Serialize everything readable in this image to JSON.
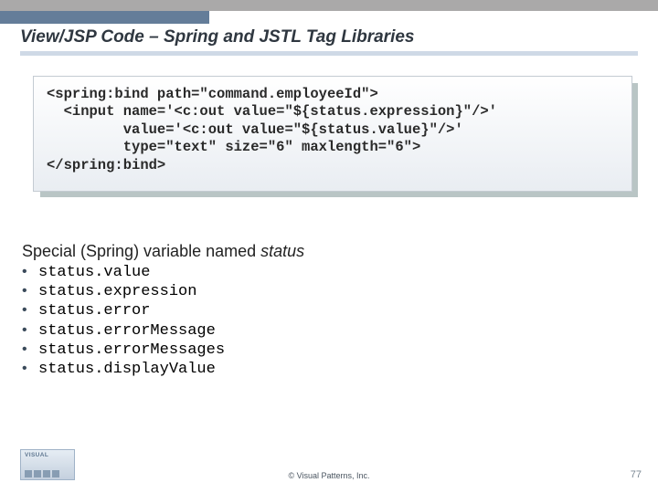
{
  "title": "View/JSP Code – Spring and JSTL Tag Libraries",
  "code": {
    "l1": "<spring:bind path=\"command.employeeId\">",
    "l2": "  <input name='<c:out value=\"${status.expression}\"/>'",
    "l3": "         value='<c:out value=\"${status.value}\"/>'",
    "l4": "         type=\"text\" size=\"6\" maxlength=\"6\">",
    "l5": "</spring:bind>"
  },
  "section": {
    "prefix": "Special (Spring) variable named ",
    "status_word": "status"
  },
  "vars": [
    "status.value",
    "status.expression",
    "status.error",
    "status.errorMessage",
    "status.errorMessages",
    "status.displayValue"
  ],
  "logo": {
    "text": "VISUAL"
  },
  "footer": "© Visual Patterns, Inc.",
  "page_number": "77"
}
